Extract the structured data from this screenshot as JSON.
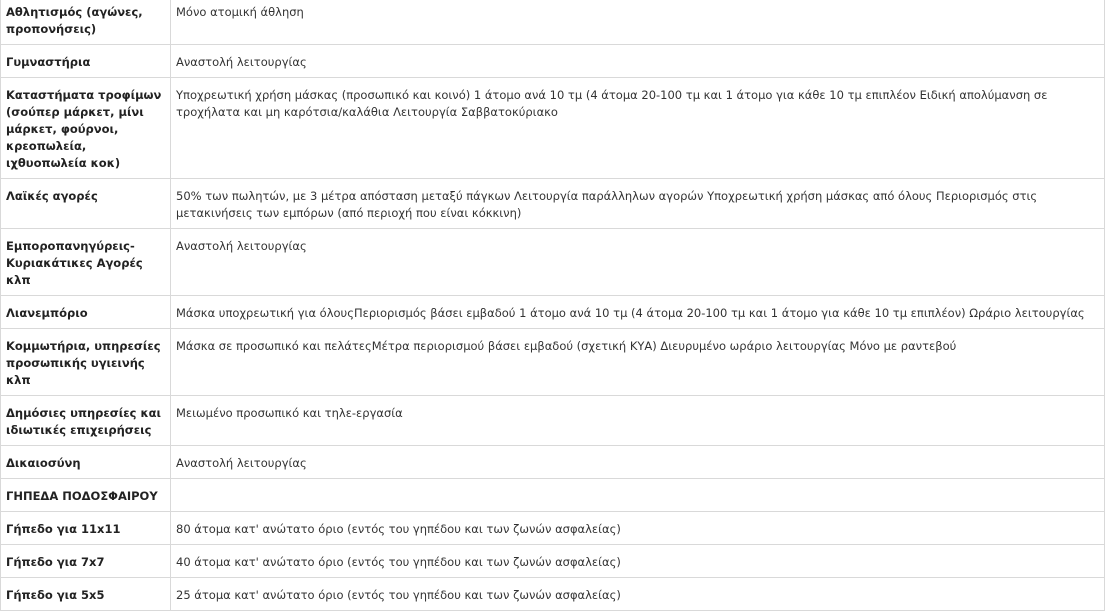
{
  "rows": [
    {
      "category": "Αθλητισμός (αγώνες, προπονήσεις)",
      "description": "Μόνο ατομική άθληση"
    },
    {
      "category": "Γυμναστήρια",
      "description": "Αναστολή λειτουργίας"
    },
    {
      "category": "Καταστήματα τροφίμων (σούπερ μάρκετ, μίνι μάρκετ, φούρνοι, κρεοπωλεία, ιχθυοπωλεία κοκ)",
      "description": "Υποχρεωτική χρήση μάσκας (προσωπικό και κοινό) 1 άτομο ανά 10 τμ (4 άτομα 20-100 τμ και 1 άτομο για κάθε 10 τμ επιπλέον Ειδική απολύμανση σε τροχήλατα και μη καρότσια/καλάθια Λειτουργία Σαββατοκύριακο"
    },
    {
      "category": "Λαϊκές αγορές",
      "description": "50% των πωλητών, με 3 μέτρα απόσταση μεταξύ πάγκων Λειτουργία παράλληλων αγορών Υποχρεωτική χρήση μάσκας από όλους Περιορισμός στις μετακινήσεις των εμπόρων (από περιοχή που είναι κόκκινη)"
    },
    {
      "category": "Εμποροπανηγύρεις-Κυριακάτικες Αγορές κλπ",
      "description": "Αναστολή λειτουργίας"
    },
    {
      "category": "Λιανεμπόριο",
      "description": "Μάσκα υποχρεωτική για όλουςΠεριορισμός βάσει εμβαδού 1 άτομο ανά 10 τμ (4 άτομα 20-100 τμ και 1 άτομο για κάθε 10 τμ επιπλέον) Ωράριο λειτουργίας"
    },
    {
      "category": "Κομμωτήρια, υπηρεσίες προσωπικής υγιεινής κλπ",
      "description": "Μάσκα σε προσωπικό και πελάτεςΜέτρα περιορισμού βάσει εμβαδού (σχετική ΚΥΑ) Διευρυμένο ωράριο λειτουργίας Μόνο με ραντεβού"
    },
    {
      "category": "Δημόσιες υπηρεσίες και ιδιωτικές επιχειρήσεις",
      "description": "Μειωμένο προσωπικό και τηλε-εργασία"
    },
    {
      "category": "Δικαιοσύνη",
      "description": "Αναστολή λειτουργίας"
    },
    {
      "category": "ΓΗΠΕΔΑ ΠΟΔΟΣΦΑΙΡΟΥ",
      "description": ""
    },
    {
      "category": "Γήπεδο για 11x11",
      "description": "80 άτομα κατ' ανώτατο όριο (εντός του γηπέδου και των ζωνών ασφαλείας)"
    },
    {
      "category": "Γήπεδο για 7x7",
      "description": "40 άτομα κατ' ανώτατο όριο (εντός του γηπέδου και των ζωνών ασφαλείας)"
    },
    {
      "category": "Γήπεδο για 5x5",
      "description": "25 άτομα κατ' ανώτατο όριο (εντός του γηπέδου και των ζωνών ασφαλείας)"
    }
  ]
}
